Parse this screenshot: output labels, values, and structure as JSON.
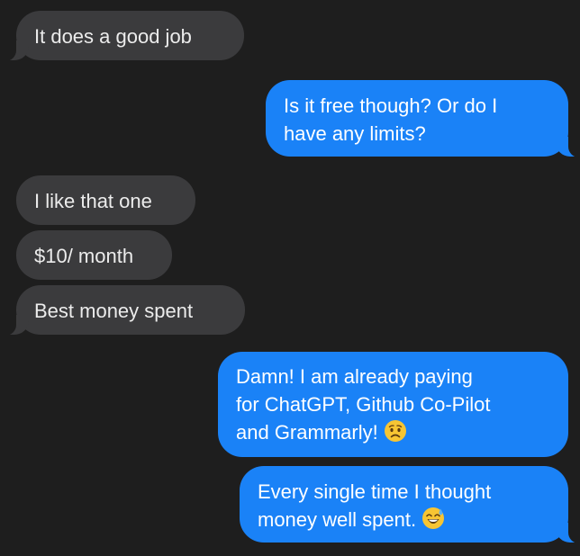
{
  "messages": [
    {
      "direction": "received",
      "lines": [
        "It does a good job"
      ]
    },
    {
      "direction": "sent",
      "lines": [
        "Is it free though? Or do I",
        "have any limits?"
      ]
    },
    {
      "direction": "received",
      "lines": [
        "I like that one"
      ]
    },
    {
      "direction": "received",
      "lines": [
        "$10/ month"
      ]
    },
    {
      "direction": "received",
      "lines": [
        "Best money spent"
      ]
    },
    {
      "direction": "sent",
      "lines": [
        "Damn! I am already paying",
        "for ChatGPT, Github Co-Pilot",
        "and Grammarly!"
      ],
      "emoji": "worried-face-icon"
    },
    {
      "direction": "sent",
      "lines": [
        "Every single time I thought",
        "money well spent."
      ],
      "emoji": "grinning-sweat-face-icon"
    }
  ],
  "colors": {
    "background": "#1e1e1e",
    "received_bubble": "#3b3b3d",
    "sent_bubble": "#1a82f7"
  }
}
